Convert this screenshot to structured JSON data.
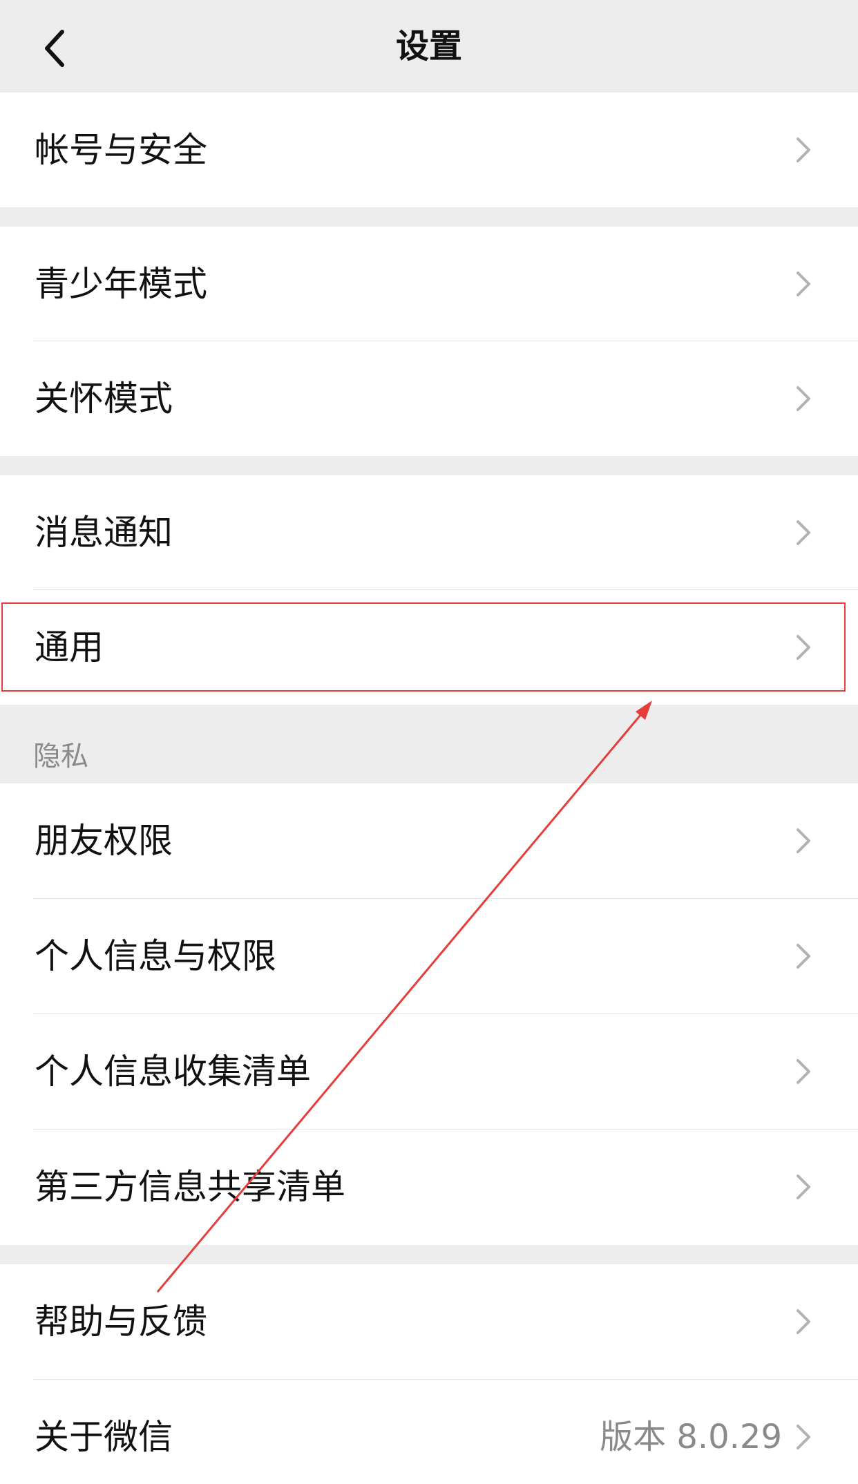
{
  "header": {
    "title": "设置",
    "back_icon": "chevron-left-icon"
  },
  "groups": {
    "account": [
      {
        "label": "帐号与安全"
      }
    ],
    "modes": [
      {
        "label": "青少年模式"
      },
      {
        "label": "关怀模式"
      }
    ],
    "notify": [
      {
        "label": "消息通知"
      },
      {
        "label": "通用"
      }
    ],
    "privacy_label": "隐私",
    "privacy": [
      {
        "label": "朋友权限"
      },
      {
        "label": "个人信息与权限"
      },
      {
        "label": "个人信息收集清单"
      },
      {
        "label": "第三方信息共享清单"
      }
    ],
    "help": [
      {
        "label": "帮助与反馈"
      },
      {
        "label": "关于微信",
        "value": "版本 8.0.29"
      }
    ]
  },
  "colors": {
    "background": "#ededed",
    "card": "#ffffff",
    "text": "#111111",
    "secondary_text": "#8a8a8a",
    "annotation_red": "#e53c3c"
  },
  "icons": {
    "row_chevron": "chevron-right-icon"
  }
}
